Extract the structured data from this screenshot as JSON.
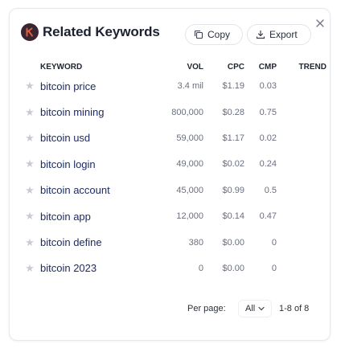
{
  "header": {
    "title": "Related Keywords",
    "copy_label": "Copy",
    "export_label": "Export"
  },
  "table": {
    "columns": [
      "KEYWORD",
      "VOL",
      "CPC",
      "CMP",
      "TREND"
    ],
    "rows": [
      {
        "keyword": "bitcoin price",
        "vol": "3.4 mil",
        "cpc": "$1.19",
        "cmp": "0.03"
      },
      {
        "keyword": "bitcoin mining",
        "vol": "800,000",
        "cpc": "$0.28",
        "cmp": "0.75"
      },
      {
        "keyword": "bitcoin usd",
        "vol": "59,000",
        "cpc": "$1.17",
        "cmp": "0.02"
      },
      {
        "keyword": "bitcoin login",
        "vol": "49,000",
        "cpc": "$0.02",
        "cmp": "0.24"
      },
      {
        "keyword": "bitcoin account",
        "vol": "45,000",
        "cpc": "$0.99",
        "cmp": "0.5"
      },
      {
        "keyword": "bitcoin app",
        "vol": "12,000",
        "cpc": "$0.14",
        "cmp": "0.47"
      },
      {
        "keyword": "bitcoin define",
        "vol": "380",
        "cpc": "$0.00",
        "cmp": "0"
      },
      {
        "keyword": "bitcoin 2023",
        "vol": "0",
        "cpc": "$0.00",
        "cmp": "0"
      }
    ]
  },
  "footer": {
    "per_page_label": "Per page:",
    "per_page_value": "All",
    "range": "1-8 of 8"
  },
  "icons": {
    "logo": "keywords-everywhere-logo",
    "copy": "copy-icon",
    "export": "download-icon",
    "close": "close-icon",
    "star": "star-icon",
    "chevron": "chevron-down-icon"
  },
  "colors": {
    "logo_bg": "#3a2530",
    "keyword_text": "#1d2b66",
    "muted_text": "#6b7080",
    "star": "#c8cbd3"
  }
}
